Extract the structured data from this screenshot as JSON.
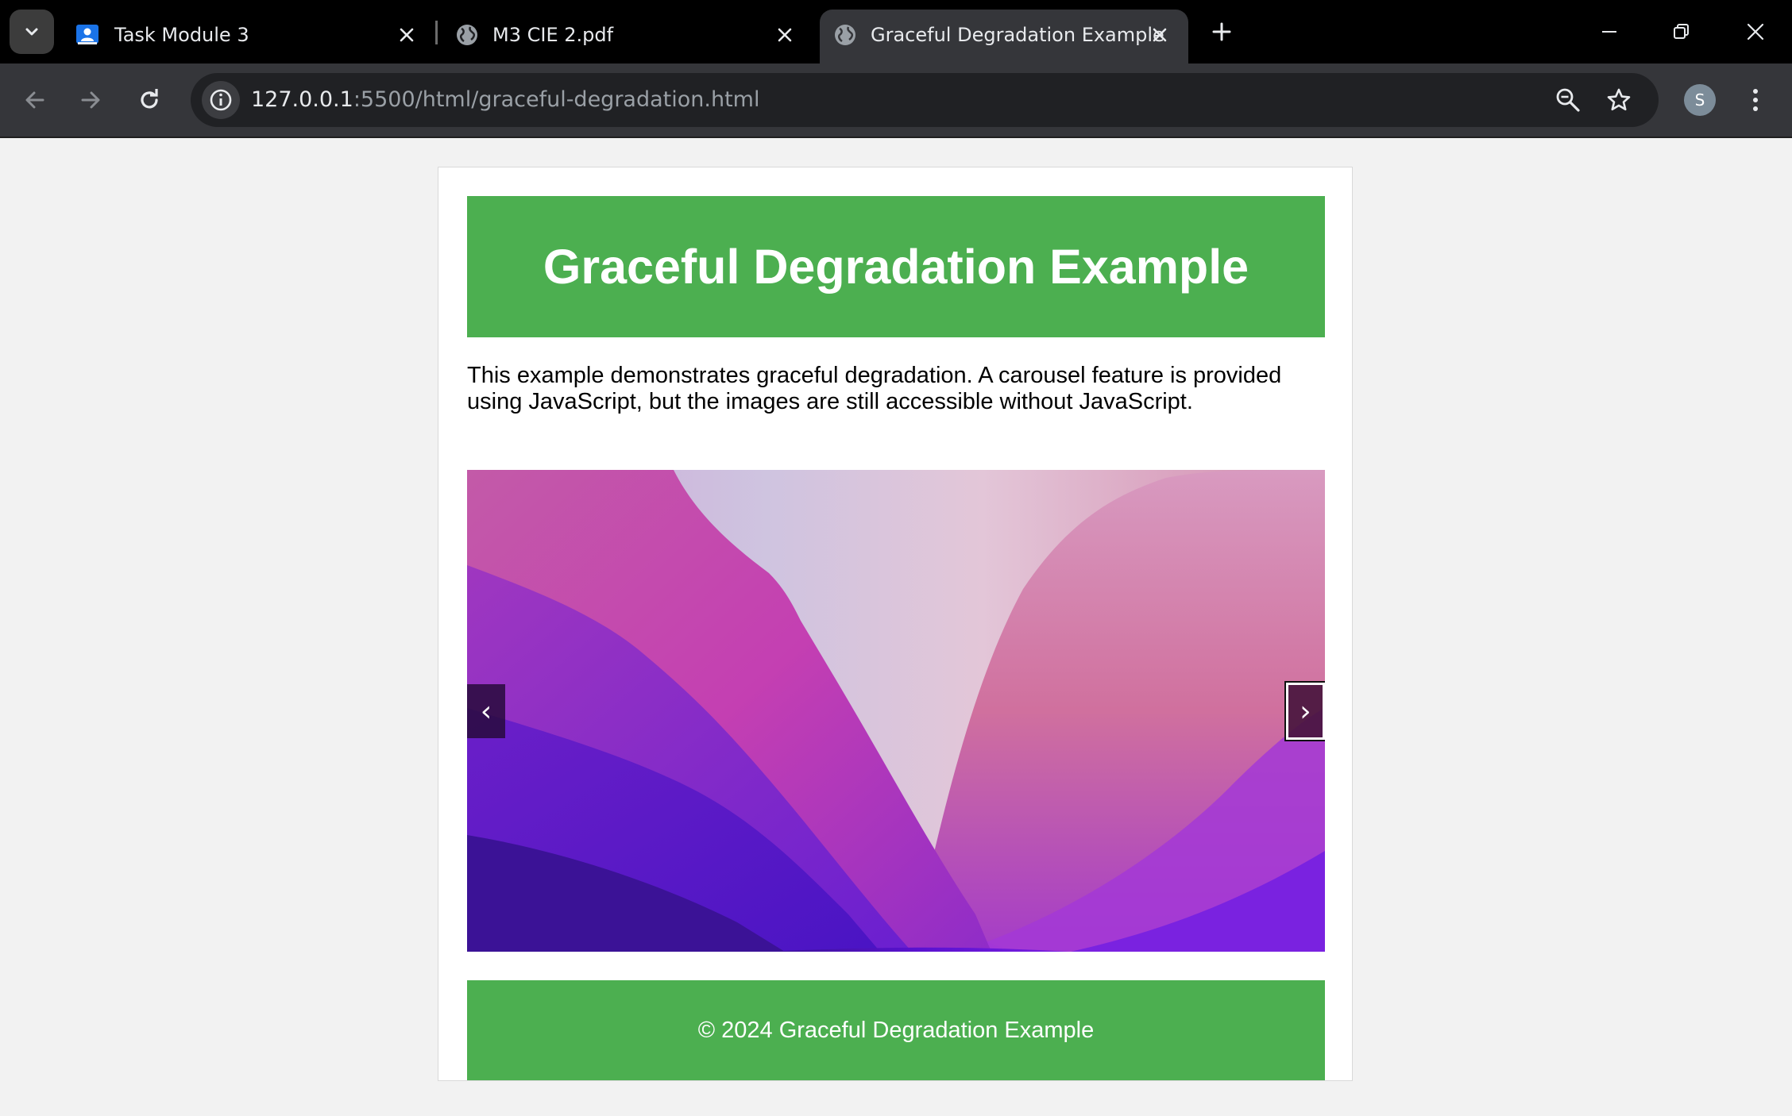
{
  "browser": {
    "tabs": [
      {
        "title": "Task Module 3",
        "icon": "classroom-icon",
        "active": false
      },
      {
        "title": "M3 CIE 2.pdf",
        "icon": "globe-icon",
        "active": false
      },
      {
        "title": "Graceful Degradation Example",
        "icon": "globe-icon",
        "active": true
      }
    ],
    "address": {
      "host": "127.0.0.1",
      "path": ":5500/html/graceful-degradation.html"
    },
    "profile_initial": "S"
  },
  "page": {
    "header_title": "Graceful Degradation Example",
    "intro": "This example demonstrates graceful degradation. A carousel feature is provided using JavaScript, but the images are still accessible without JavaScript.",
    "carousel": {
      "prev_label": "‹",
      "next_label": "›",
      "image": "mountain-gradient-wallpaper"
    },
    "footer_text": "© 2024 Graceful Degradation Example"
  },
  "colors": {
    "accent_green": "#4caf50",
    "chrome_dark": "#35363a"
  }
}
